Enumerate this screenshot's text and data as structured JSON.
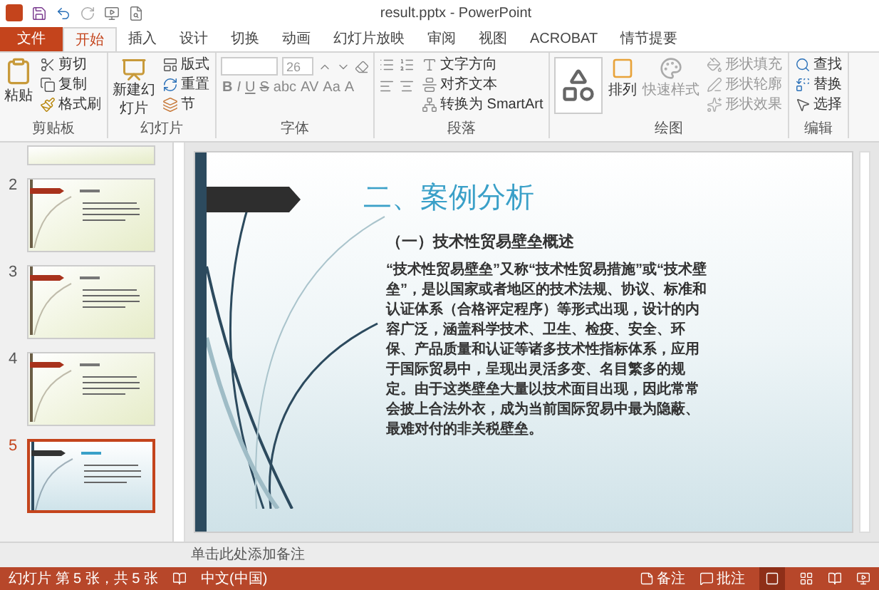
{
  "window": {
    "title": "result.pptx - PowerPoint"
  },
  "tabs": [
    {
      "label": "文件",
      "kind": "file",
      "selected": false
    },
    {
      "label": "开始",
      "kind": "tab",
      "selected": true
    },
    {
      "label": "插入",
      "kind": "tab",
      "selected": false
    },
    {
      "label": "设计",
      "kind": "tab",
      "selected": false
    },
    {
      "label": "切换",
      "kind": "tab",
      "selected": false
    },
    {
      "label": "动画",
      "kind": "tab",
      "selected": false
    },
    {
      "label": "幻灯片放映",
      "kind": "tab",
      "selected": false
    },
    {
      "label": "审阅",
      "kind": "tab",
      "selected": false
    },
    {
      "label": "视图",
      "kind": "tab",
      "selected": false
    },
    {
      "label": "ACROBAT",
      "kind": "tab",
      "selected": false
    },
    {
      "label": "情节提要",
      "kind": "tab",
      "selected": false
    }
  ],
  "ribbon": [
    {
      "kind": "clipboard",
      "label": "剪贴板",
      "items": [
        "粘贴",
        "剪切",
        "复制",
        "格式刷"
      ]
    },
    {
      "kind": "slides",
      "label": "幻灯片",
      "items": [
        "新建幻灯片",
        "版式",
        "重置",
        "节"
      ]
    },
    {
      "kind": "font",
      "label": "字体",
      "size": "26",
      "items": [
        "B",
        "I",
        "U",
        "S",
        "abc",
        "AV",
        "Aa",
        "A"
      ]
    },
    {
      "kind": "paragraph",
      "label": "段落",
      "items": [
        "文字方向",
        "对齐文本",
        "转换为 SmartArt"
      ]
    },
    {
      "kind": "drawing",
      "label": "绘图",
      "items": [
        "排列",
        "快速样式",
        "形状填充",
        "形状轮廓",
        "形状效果"
      ]
    },
    {
      "kind": "editing",
      "label": "编辑",
      "items": [
        "查找",
        "替换",
        "选择"
      ]
    }
  ],
  "thumbnails": [
    {
      "kind": "green",
      "selected": false
    },
    {
      "number": "2",
      "kind": "green",
      "selected": false
    },
    {
      "number": "3",
      "kind": "green",
      "selected": false
    },
    {
      "number": "4",
      "kind": "green",
      "selected": false
    },
    {
      "number": "5",
      "kind": "blue",
      "selected": true
    }
  ],
  "slide": {
    "title": "二、案例分析",
    "subtitle": "（一）技术性贸易壁垒概述",
    "body": "“技术性贸易壁垒”又称“技术性贸易措施”或“技术壁垒”，是以国家或者地区的技术法规、协议、标准和认证体系（合格评定程序）等形式出现，设计的内容广泛，涵盖科学技术、卫生、检疫、安全、环保、产品质量和认证等诸多技术性指标体系，应用于国际贸易中，呈现出灵活多变、名目繁多的规定。由于这类壁垒大量以技术面目出现，因此常常会披上合法外衣，成为当前国际贸易中最为隐蔽、最难对付的非关税壁垒。"
  },
  "notes": {
    "placeholder": "单击此处添加备注"
  },
  "status_bar": {
    "slide_info": "幻灯片 第 5 张，共 5 张",
    "language": "中文(中国)",
    "notes": "备注",
    "comments": "批注"
  }
}
